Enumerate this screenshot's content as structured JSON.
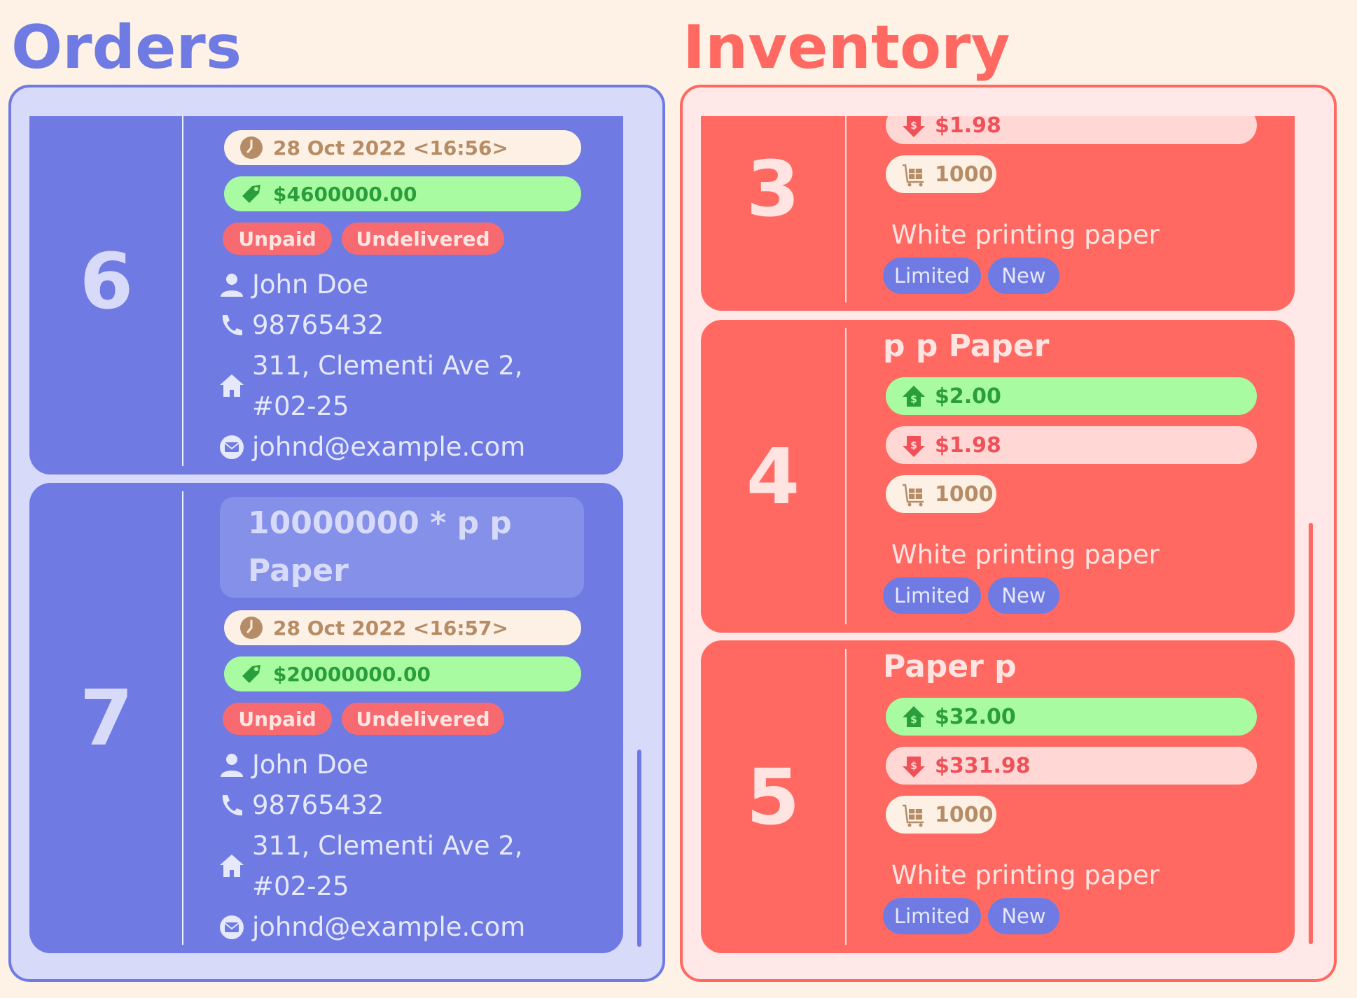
{
  "orders": {
    "title": "Orders",
    "cards": [
      {
        "index": "6",
        "date": "28 Oct 2022 <16:56>",
        "price": "$4600000.00",
        "payment_status": "Unpaid",
        "delivery_status": "Undelivered",
        "name": "John Doe",
        "phone": "98765432",
        "address_line1": "311, Clementi Ave 2,",
        "address_line2": "#02-25",
        "email": "johnd@example.com"
      },
      {
        "index": "7",
        "title_line1": "10000000 * p p",
        "title_line2": "Paper",
        "date": "28 Oct 2022 <16:57>",
        "price": "$20000000.00",
        "payment_status": "Unpaid",
        "delivery_status": "Undelivered",
        "name": "John Doe",
        "phone": "98765432",
        "address_line1": "311, Clementi Ave 2,",
        "address_line2": "#02-25",
        "email": "johnd@example.com"
      }
    ]
  },
  "inventory": {
    "title": "Inventory",
    "cards": [
      {
        "index": "3",
        "cost_price": "$1.98",
        "quantity": "1000",
        "description": "White printing paper",
        "tags": [
          "Limited",
          "New"
        ]
      },
      {
        "index": "4",
        "name": "p p Paper",
        "sell_price": "$2.00",
        "cost_price": "$1.98",
        "quantity": "1000",
        "description": "White printing paper",
        "tags": [
          "Limited",
          "New"
        ]
      },
      {
        "index": "5",
        "name": "Paper p",
        "sell_price": "$32.00",
        "cost_price": "$331.98",
        "quantity": "1000",
        "description": "White printing paper",
        "tags": [
          "Limited",
          "New"
        ]
      }
    ]
  },
  "colors": {
    "background": "#fef2e6",
    "orders_accent": "#6f7be3",
    "inventory_accent": "#ff6961",
    "price_green": "#a8fba1",
    "status_red": "#f76a70"
  },
  "icons": [
    "clock-icon",
    "price-tag-icon",
    "person-icon",
    "phone-icon",
    "home-icon",
    "email-icon",
    "sell-price-icon",
    "cost-price-icon",
    "quantity-cart-icon"
  ]
}
